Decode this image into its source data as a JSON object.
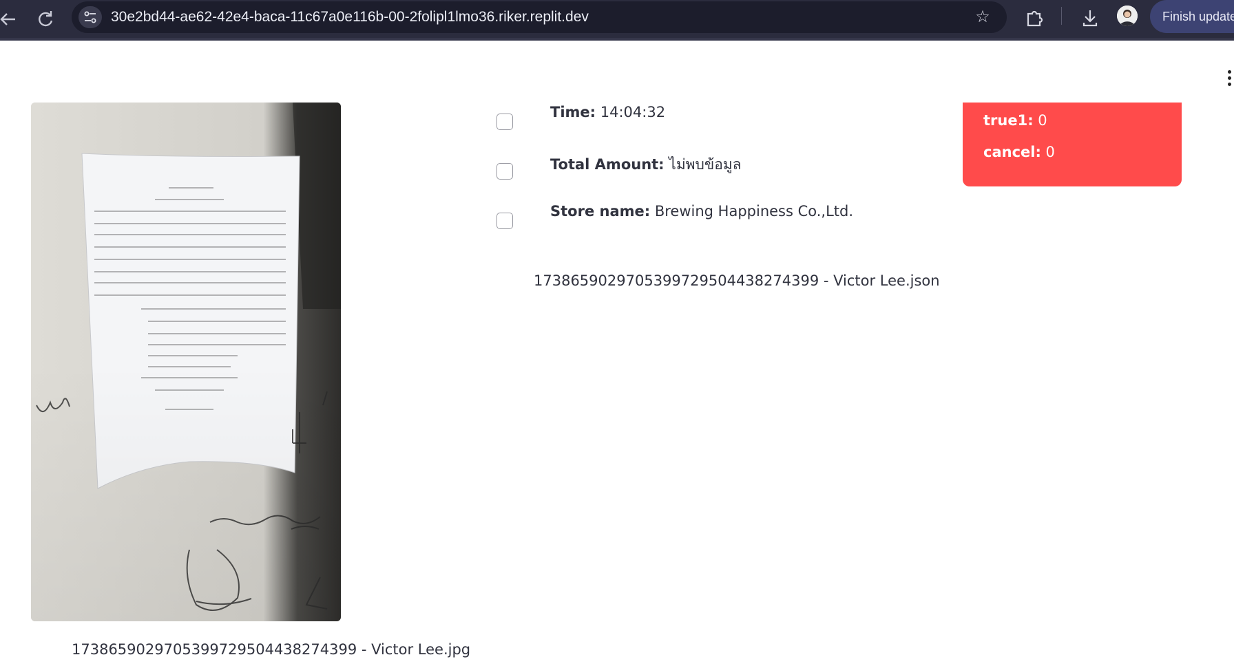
{
  "browser": {
    "url": "30e2bd44-ae62-42e4-baca-11c67a0e116b-00-2folipl1lmo36.riker.replit.dev",
    "finish_update_label": "Finish update"
  },
  "receipt_image": {
    "caption": "1738659029705399729504438274399 - Victor Lee.jpg"
  },
  "fields": {
    "time": {
      "label": "Time:",
      "value": "14:04:32"
    },
    "total_amount": {
      "label": "Total Amount:",
      "value": "ไม่พบข้อมูล"
    },
    "store_name": {
      "label": "Store name:",
      "value": "Brewing Happiness Co.,Ltd."
    }
  },
  "json_file": "1738659029705399729504438274399 - Victor Lee.json",
  "stats": {
    "true1": {
      "label": "true1:",
      "value": "0"
    },
    "cancel": {
      "label": "cancel:",
      "value": "0"
    }
  },
  "colors": {
    "chrome_bg": "#2b2c3e",
    "omnibox_bg": "#1c1d2c",
    "finish_btn": "#3d4373",
    "stats_bg": "#ff4b4b",
    "text": "#31333f"
  },
  "icons": [
    "back-arrow-icon",
    "reload-icon",
    "site-info-icon",
    "star-icon",
    "extensions-icon",
    "download-icon",
    "profile-avatar",
    "kebab-menu-icon"
  ]
}
